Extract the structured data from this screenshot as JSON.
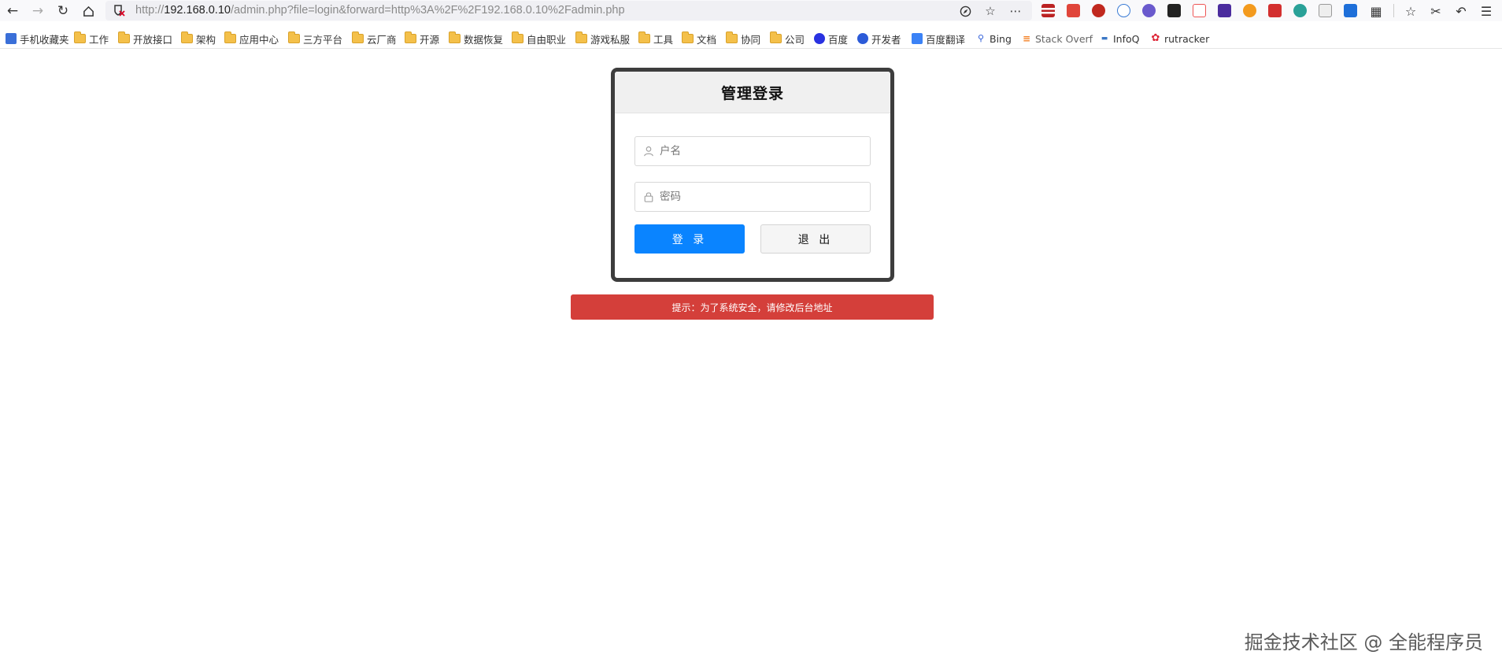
{
  "browser": {
    "url_prefix": "http://",
    "url_host": "192.168.0.10",
    "url_path": "/admin.php?file=login&forward=http%3A%2F%2F192.168.0.10%2Fadmin.php"
  },
  "bookmarks": [
    {
      "label": "手机收藏夹",
      "icon": "mobile-bookmark-icon"
    },
    {
      "label": "工作",
      "icon": "folder-icon"
    },
    {
      "label": "开放接口",
      "icon": "folder-icon"
    },
    {
      "label": "架构",
      "icon": "folder-icon"
    },
    {
      "label": "应用中心",
      "icon": "folder-icon"
    },
    {
      "label": "三方平台",
      "icon": "folder-icon"
    },
    {
      "label": "云厂商",
      "icon": "folder-icon"
    },
    {
      "label": "开源",
      "icon": "folder-icon"
    },
    {
      "label": "数据恢复",
      "icon": "folder-icon"
    },
    {
      "label": "自由职业",
      "icon": "folder-icon"
    },
    {
      "label": "游戏私服",
      "icon": "folder-icon"
    },
    {
      "label": "工具",
      "icon": "folder-icon"
    },
    {
      "label": "文档",
      "icon": "folder-icon"
    },
    {
      "label": "协同",
      "icon": "folder-icon"
    },
    {
      "label": "公司",
      "icon": "folder-icon"
    },
    {
      "label": "百度",
      "icon": "baidu-icon"
    },
    {
      "label": "开发者",
      "icon": "developer-icon"
    },
    {
      "label": "百度翻译",
      "icon": "baidu-translate-icon"
    },
    {
      "label": "Bing",
      "icon": "search-icon"
    },
    {
      "label": "Stack Overf",
      "icon": "stackoverflow-icon"
    },
    {
      "label": "InfoQ",
      "icon": "infoq-icon"
    },
    {
      "label": "rutracker",
      "icon": "rutracker-icon"
    }
  ],
  "login": {
    "title": "管理登录",
    "username_placeholder": "户名",
    "password_placeholder": "密码",
    "login_button": "登 录",
    "exit_button": "退 出"
  },
  "alert": {
    "text": "提示：为了系统安全，请修改后台地址"
  },
  "watermark": "掘金技术社区 @ 全能程序员",
  "colors": {
    "primary": "#0a84ff",
    "alert": "#d43f3a",
    "card_border": "#3d3d3d"
  }
}
